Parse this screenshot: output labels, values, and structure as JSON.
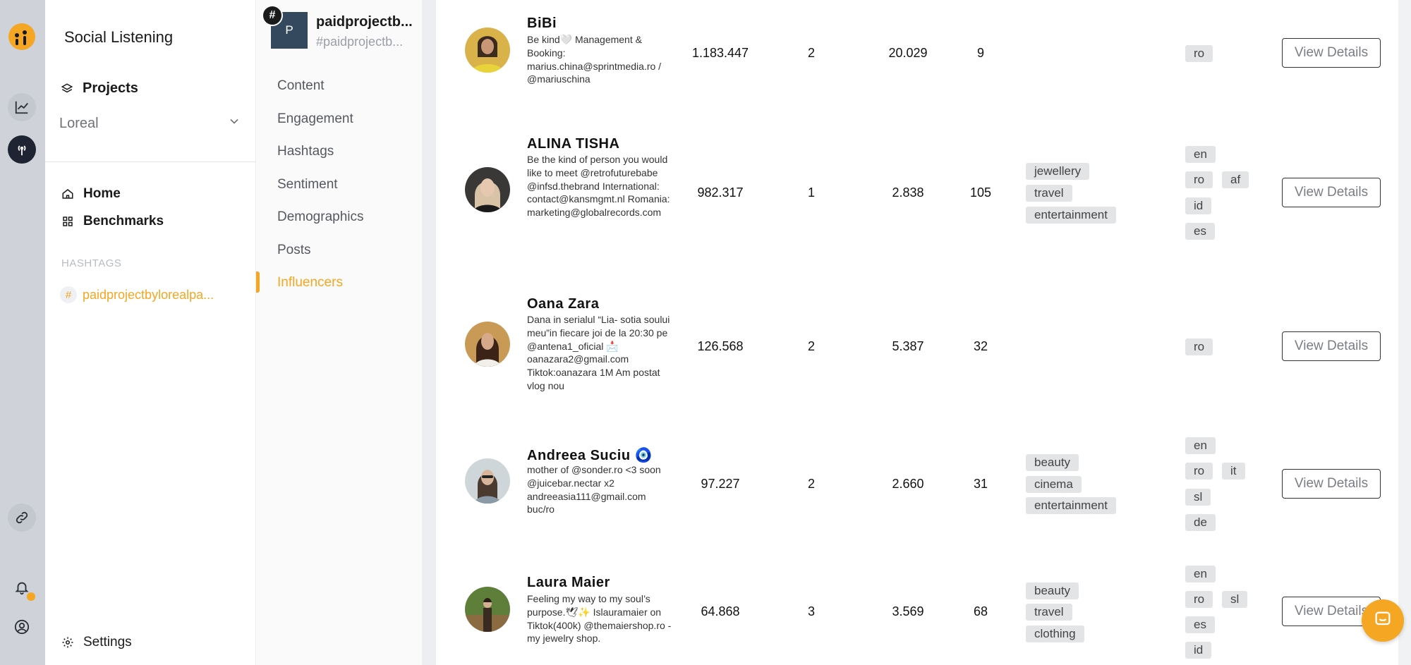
{
  "app": {
    "title": "Social Listening",
    "logo_icon": "brand-logo-icon",
    "accent_color": "#f5a623"
  },
  "rail": {
    "icons": [
      "brand-logo-icon",
      "chart-line-icon",
      "broadcast-icon",
      "link-icon",
      "bell-icon",
      "user-circle-icon"
    ]
  },
  "sidebar": {
    "projects_label": "Projects",
    "project_selected": "Loreal",
    "nav": [
      {
        "label": "Home",
        "icon": "home-icon"
      },
      {
        "label": "Benchmarks",
        "icon": "grid-icon"
      }
    ],
    "hashtags_heading": "HASHTAGS",
    "hashtag": "paidprojectbylorealpa...",
    "settings_label": "Settings"
  },
  "project": {
    "avatar_letter": "P",
    "name": "paidprojectb...",
    "handle": "#paidprojectb..."
  },
  "subnav": {
    "items": [
      "Content",
      "Engagement",
      "Hashtags",
      "Sentiment",
      "Demographics",
      "Posts",
      "Influencers"
    ],
    "active": "Influencers"
  },
  "influencers": [
    {
      "name": "BiBi",
      "bio": "Be kind🤍 Management & Booking: marius.china@sprintmedia.ro / @mariuschina",
      "followers": "1.183.447",
      "posts": "2",
      "engagement": "20.029",
      "count": "9",
      "categories": [],
      "languages": [
        "ro"
      ],
      "action": "View Details"
    },
    {
      "name": "ALINA TISHA",
      "bio": "Be the kind of person you would like to meet @retrofuturebabe @infsd.thebrand International: contact@kansmgmt.nl Romania: marketing@globalrecords.com",
      "followers": "982.317",
      "posts": "1",
      "engagement": "2.838",
      "count": "105",
      "categories": [
        "jewellery",
        "travel",
        "entertainment"
      ],
      "languages": [
        "en",
        "ro",
        "af",
        "id",
        "es"
      ],
      "action": "View Details"
    },
    {
      "name": "Oana Zara",
      "bio": "Dana in serialul “Lia- sotia soului meu”in fiecare joi de la 20:30 pe @antena1_oficial 📩 oanazara2@gmail.com Tiktok:oanazara 1M Am postat vlog nou",
      "followers": "126.568",
      "posts": "2",
      "engagement": "5.387",
      "count": "32",
      "categories": [],
      "languages": [
        "ro"
      ],
      "action": "View Details"
    },
    {
      "name": "Andreea Suciu 🧿",
      "bio": "mother of @sonder.ro <3 soon @juicebar.nectar x2 andreeasia111@gmail.com buc/ro",
      "followers": "97.227",
      "posts": "2",
      "engagement": "2.660",
      "count": "31",
      "categories": [
        "beauty",
        "cinema",
        "entertainment"
      ],
      "languages": [
        "en",
        "ro",
        "it",
        "sl",
        "de"
      ],
      "action": "View Details"
    },
    {
      "name": "Laura Maier",
      "bio": "Feeling my way to my soul’s purpose.🕊✨ Islauramaier on Tiktok(400k) @themaiershop.ro - my jewelry shop.",
      "followers": "64.868",
      "posts": "3",
      "engagement": "3.569",
      "count": "68",
      "categories": [
        "beauty",
        "travel",
        "clothing"
      ],
      "languages": [
        "en",
        "ro",
        "sl",
        "es",
        "id"
      ],
      "action": "View Details"
    }
  ],
  "chat": {
    "icon": "chat-bubble-icon"
  }
}
